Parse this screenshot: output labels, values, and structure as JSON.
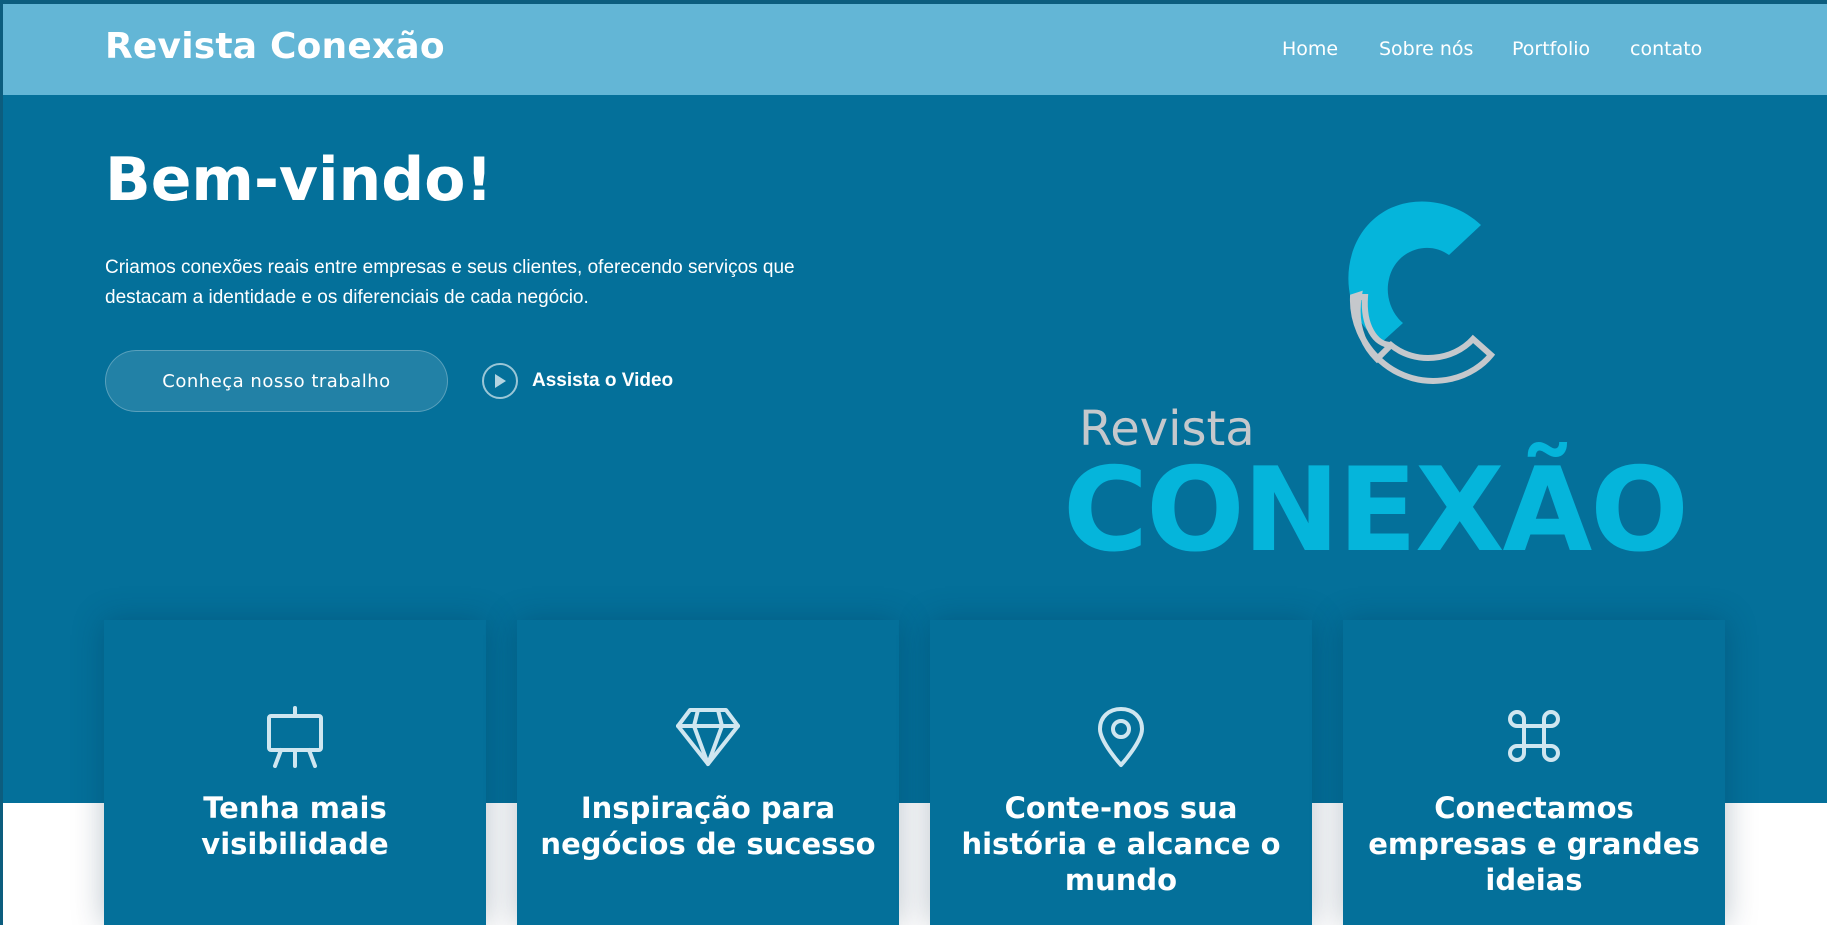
{
  "header": {
    "brand": "Revista Conexão",
    "nav": [
      {
        "label": "Home"
      },
      {
        "label": "Sobre nós"
      },
      {
        "label": "Portfolio"
      },
      {
        "label": "contato"
      }
    ]
  },
  "hero": {
    "title": "Bem-vindo!",
    "description": "Criamos conexões reais entre empresas e seus clientes, oferecendo serviços que destacam a identidade e os diferenciais de cada negócio.",
    "cta_label": "Conheça nosso trabalho",
    "video_label": "Assista o Video",
    "video_icon": "play-circle-icon",
    "logo": {
      "top_text": "Revista",
      "main_text": "CONEXÃO"
    }
  },
  "cards": [
    {
      "icon": "presentation-board-icon",
      "title": "Tenha mais visibilidade"
    },
    {
      "icon": "diamond-icon",
      "title": "Inspiração para negócios de sucesso"
    },
    {
      "icon": "map-pin-icon",
      "title": "Conte-nos sua história e alcance o mundo"
    },
    {
      "icon": "command-icon",
      "title": "Conectamos empresas e grandes ideias"
    }
  ],
  "colors": {
    "navbar": "#63b6d6",
    "hero": "#04709a",
    "logo_accent": "#05b5db",
    "logo_gray": "#c5c8cc",
    "text": "#ffffff"
  }
}
